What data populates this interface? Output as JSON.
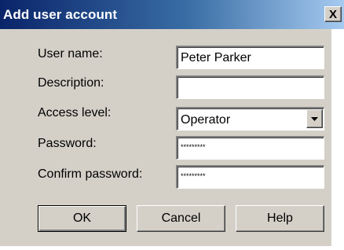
{
  "dialog": {
    "title": "Add user account",
    "close_label": "X"
  },
  "form": {
    "user_name_label": "User name:",
    "user_name_value": "Peter Parker",
    "description_label": "Description:",
    "description_value": "",
    "access_level_label": "Access level:",
    "access_level_value": "Operator",
    "password_label": "Password:",
    "password_value": "*********",
    "confirm_password_label": "Confirm password:",
    "confirm_password_value": "*********"
  },
  "buttons": {
    "ok_label": "OK",
    "cancel_label": "Cancel",
    "help_label": "Help"
  },
  "icons": {
    "close": "close-icon",
    "dropdown": "chevron-down-icon"
  },
  "colors": {
    "title_bar_start": "#0a246a",
    "title_bar_end": "#a6caf0",
    "dialog_face": "#d4d0c8"
  }
}
